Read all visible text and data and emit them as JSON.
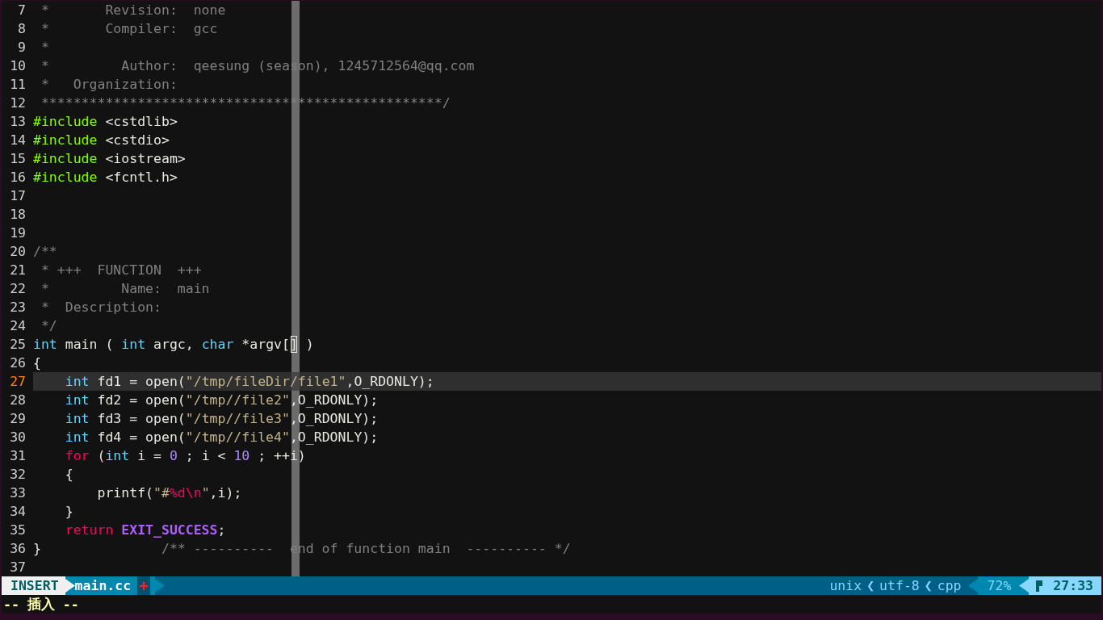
{
  "editor": {
    "lines": [
      {
        "number": "7",
        "current": false,
        "segments": [
          {
            "kind": "comment",
            "text": " *       Revision:  none"
          }
        ]
      },
      {
        "number": "8",
        "current": false,
        "segments": [
          {
            "kind": "comment",
            "text": " *       Compiler:  gcc"
          }
        ]
      },
      {
        "number": "9",
        "current": false,
        "segments": [
          {
            "kind": "comment",
            "text": " *"
          }
        ]
      },
      {
        "number": "10",
        "current": false,
        "segments": [
          {
            "kind": "comment",
            "text": " *         Author:  qeesung (season), 1245712564@qq.com"
          }
        ]
      },
      {
        "number": "11",
        "current": false,
        "segments": [
          {
            "kind": "comment",
            "text": " *   Organization:"
          }
        ]
      },
      {
        "number": "12",
        "current": false,
        "segments": [
          {
            "kind": "comment",
            "text": " **************************************************/"
          }
        ]
      },
      {
        "number": "13",
        "current": false,
        "segments": [
          {
            "kind": "preproc",
            "text": "#include"
          },
          {
            "kind": "normal",
            "text": " <cstdlib>"
          }
        ]
      },
      {
        "number": "14",
        "current": false,
        "segments": [
          {
            "kind": "preproc",
            "text": "#include"
          },
          {
            "kind": "normal",
            "text": " <cstdio>"
          }
        ]
      },
      {
        "number": "15",
        "current": false,
        "segments": [
          {
            "kind": "preproc",
            "text": "#include"
          },
          {
            "kind": "normal",
            "text": " <iostream>"
          }
        ]
      },
      {
        "number": "16",
        "current": false,
        "segments": [
          {
            "kind": "preproc",
            "text": "#include"
          },
          {
            "kind": "normal",
            "text": " <fcntl.h>"
          }
        ]
      },
      {
        "number": "17",
        "current": false
      },
      {
        "number": "18",
        "current": false
      },
      {
        "number": "19",
        "current": false
      },
      {
        "number": "20",
        "current": false,
        "segments": [
          {
            "kind": "comment",
            "text": "/**"
          }
        ]
      },
      {
        "number": "21",
        "current": false,
        "segments": [
          {
            "kind": "comment",
            "text": " * +++  FUNCTION  +++"
          }
        ]
      },
      {
        "number": "22",
        "current": false,
        "segments": [
          {
            "kind": "comment",
            "text": " *         Name:  main"
          }
        ]
      },
      {
        "number": "23",
        "current": false,
        "segments": [
          {
            "kind": "comment",
            "text": " *  Description:"
          }
        ]
      },
      {
        "number": "24",
        "current": false,
        "segments": [
          {
            "kind": "comment",
            "text": " */"
          }
        ]
      },
      {
        "number": "25",
        "current": false,
        "segments": [
          {
            "kind": "type",
            "text": "int"
          },
          {
            "kind": "normal",
            "text": " main ( "
          },
          {
            "kind": "type",
            "text": "int"
          },
          {
            "kind": "normal",
            "text": " argc, "
          },
          {
            "kind": "type",
            "text": "char"
          },
          {
            "kind": "normal",
            "text": " *argv["
          },
          {
            "kind": "match",
            "text": "]"
          },
          {
            "kind": "normal",
            "text": " )"
          }
        ]
      },
      {
        "number": "26",
        "current": false,
        "segments": [
          {
            "kind": "normal",
            "text": "{"
          }
        ]
      },
      {
        "number": "27",
        "current": true,
        "segments": [
          {
            "kind": "type",
            "text": "    int"
          },
          {
            "kind": "normal",
            "text": " fd1 = open("
          },
          {
            "kind": "string",
            "text": "\"/tmp/fileDir/file1\""
          },
          {
            "kind": "normal",
            "text": ",O_RDONLY);"
          }
        ]
      },
      {
        "number": "28",
        "current": false,
        "segments": [
          {
            "kind": "type",
            "text": "    int"
          },
          {
            "kind": "normal",
            "text": " fd2 = open("
          },
          {
            "kind": "string",
            "text": "\"/tmp//file2\""
          },
          {
            "kind": "normal",
            "text": ",O_RDONLY);"
          }
        ]
      },
      {
        "number": "29",
        "current": false,
        "segments": [
          {
            "kind": "type",
            "text": "    int"
          },
          {
            "kind": "normal",
            "text": " fd3 = open("
          },
          {
            "kind": "string",
            "text": "\"/tmp//file3\""
          },
          {
            "kind": "normal",
            "text": ",O_RDONLY);"
          }
        ]
      },
      {
        "number": "30",
        "current": false,
        "segments": [
          {
            "kind": "type",
            "text": "    int"
          },
          {
            "kind": "normal",
            "text": " fd4 = open("
          },
          {
            "kind": "string",
            "text": "\"/tmp//file4\""
          },
          {
            "kind": "normal",
            "text": ",O_RDONLY);"
          }
        ]
      },
      {
        "number": "31",
        "current": false,
        "segments": [
          {
            "kind": "keyword",
            "text": "    for"
          },
          {
            "kind": "normal",
            "text": " ("
          },
          {
            "kind": "type",
            "text": "int"
          },
          {
            "kind": "normal",
            "text": " i = "
          },
          {
            "kind": "number",
            "text": "0"
          },
          {
            "kind": "normal",
            "text": " ; i < "
          },
          {
            "kind": "number",
            "text": "10"
          },
          {
            "kind": "normal",
            "text": " ; ++i)"
          }
        ]
      },
      {
        "number": "32",
        "current": false,
        "segments": [
          {
            "kind": "normal",
            "text": "    {"
          }
        ]
      },
      {
        "number": "33",
        "current": false,
        "segments": [
          {
            "kind": "normal",
            "text": "        printf("
          },
          {
            "kind": "string",
            "text": "\"#"
          },
          {
            "kind": "special",
            "text": "%d\\n"
          },
          {
            "kind": "string",
            "text": "\""
          },
          {
            "kind": "normal",
            "text": ",i);"
          }
        ]
      },
      {
        "number": "34",
        "current": false,
        "segments": [
          {
            "kind": "normal",
            "text": "    }"
          }
        ]
      },
      {
        "number": "35",
        "current": false,
        "segments": [
          {
            "kind": "keyword",
            "text": "    return "
          },
          {
            "kind": "constant",
            "text": "EXIT_SUCCESS"
          },
          {
            "kind": "normal",
            "text": ";"
          }
        ]
      },
      {
        "number": "36",
        "current": false,
        "segments": [
          {
            "kind": "normal",
            "text": "}"
          },
          {
            "kind": "comment",
            "text": "               /** ----------  end of function main  ---------- */"
          }
        ]
      },
      {
        "number": "37",
        "current": false
      }
    ]
  },
  "status_bar": {
    "mode": "INSERT",
    "file": "main.cc",
    "modified": true,
    "modified_mark": "+",
    "info": [
      {
        "kind": "text",
        "text": "unix"
      },
      {
        "kind": "separator",
        "text": "❮"
      },
      {
        "kind": "text",
        "text": "utf-8"
      },
      {
        "kind": "separator",
        "text": "❮"
      },
      {
        "kind": "text",
        "text": "cpp"
      }
    ],
    "percent": "72%",
    "position": "27:33"
  },
  "command_line": "-- 插入 --"
}
